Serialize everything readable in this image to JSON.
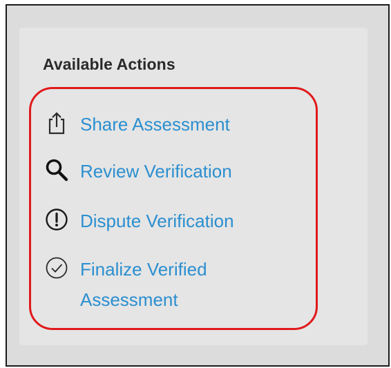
{
  "panel": {
    "title": "Available Actions"
  },
  "actions": [
    {
      "id": "share",
      "label": "Share Assessment",
      "icon": "share-icon"
    },
    {
      "id": "review",
      "label": "Review Verification",
      "icon": "search-icon"
    },
    {
      "id": "dispute",
      "label": "Dispute Verification",
      "icon": "exclamation-circle-icon"
    },
    {
      "id": "finalize",
      "label": "Finalize Verified Assessment",
      "icon": "check-circle-icon"
    }
  ],
  "colors": {
    "link": "#2b8fd0",
    "highlight": "#e0191b",
    "panel_background": "#e5e5e5",
    "page_background": "#dcdcdc"
  }
}
